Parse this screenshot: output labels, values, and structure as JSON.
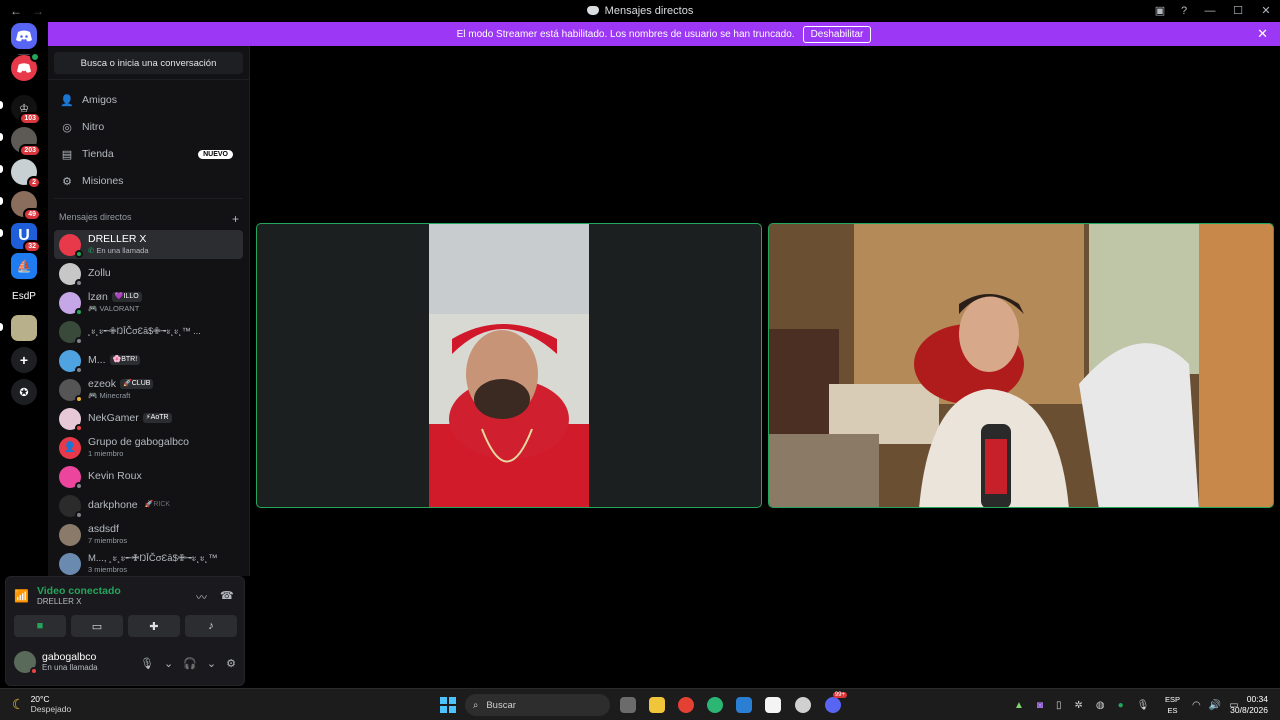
{
  "window": {
    "title": "Mensajes directos",
    "back_icon": "←",
    "forward_icon": "→",
    "inbox_icon": "▣",
    "help_icon": "?",
    "minimize_icon": "—",
    "maximize_icon": "☐",
    "close_icon": "✕"
  },
  "banner": {
    "text": "El modo Streamer está habilitado. Los nombres de usuario se han truncado.",
    "button": "Deshabilitar",
    "close": "✕",
    "color": "#9b37f5"
  },
  "servers": [
    {
      "label": "",
      "badge": "103"
    },
    {
      "label": "",
      "badge": "203"
    },
    {
      "label": "",
      "badge": "2"
    },
    {
      "label": "",
      "badge": "49"
    },
    {
      "label": "U",
      "badge": "32"
    },
    {
      "label": "",
      "badge": ""
    },
    {
      "label": "EsdP",
      "badge": ""
    },
    {
      "label": "",
      "badge": ""
    }
  ],
  "sidebar": {
    "search": "Busca o inicia una conversación",
    "nav": [
      {
        "label": "Amigos",
        "icon": "friends-icon"
      },
      {
        "label": "Nitro",
        "icon": "nitro-icon"
      },
      {
        "label": "Tienda",
        "icon": "shop-icon",
        "badge": "NUEVO"
      },
      {
        "label": "Misiones",
        "icon": "quests-icon"
      }
    ],
    "dm_header": "Mensajes directos",
    "dm_add": "+",
    "dms": [
      {
        "name": "DRELLER X",
        "sub": "En una llamada",
        "tag": ""
      },
      {
        "name": "Zollu",
        "sub": "",
        "tag": ""
      },
      {
        "name": "lzøn",
        "sub": "VALORANT",
        "tag": "💜ILLO"
      },
      {
        "name": "˛ะ˛ะ╾✙ŊĪČσƐā$✙╼ะ˛ะ˛™ ...",
        "sub": "",
        "tag": ""
      },
      {
        "name": "M...",
        "sub": "",
        "tag": "🌸BTR!"
      },
      {
        "name": "ezeok",
        "sub": "Minecraft",
        "tag": "🚀CLUB"
      },
      {
        "name": "NekGamer",
        "sub": "",
        "tag": "⚡AoTR"
      },
      {
        "name": "Grupo de gabogalbco",
        "sub": "1 miembro",
        "tag": ""
      },
      {
        "name": "Kevin Roux",
        "sub": "",
        "tag": ""
      },
      {
        "name": "darkphone",
        "sub": "",
        "tag": "🚀RICK"
      },
      {
        "name": "asdsdf",
        "sub": "7 miembros",
        "tag": ""
      },
      {
        "name": "M..., ˛ะ˛ะ╾✙ŊĪČσƐā$✙╼ะ˛ะ˛™",
        "sub": "3 miembros",
        "tag": ""
      }
    ]
  },
  "voice": {
    "status": "Video conectado",
    "channel": "DRELLER X",
    "user": "gabogalbco",
    "user_status": "En una llamada"
  },
  "taskbar": {
    "temp": "20°C",
    "weather": "Despejado",
    "search": "Buscar",
    "lang_top": "ESP",
    "lang_bottom": "ES",
    "time": "00:34",
    "date": "30/8/2026",
    "discord_badge": "99+"
  }
}
